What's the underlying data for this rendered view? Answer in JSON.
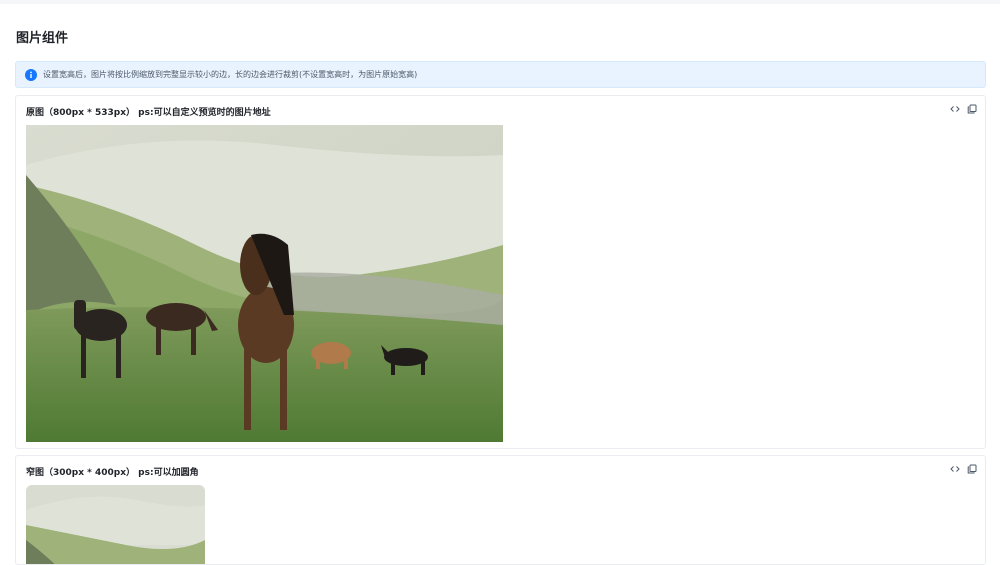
{
  "page": {
    "title": "图片组件"
  },
  "notice": {
    "icon": "info-icon",
    "text": "设置宽高后，图片将按比例缩放到完整显示较小的边，长的边会进行裁剪(不设置宽高时，为图片原始宽高)",
    "accent": "#1677ff"
  },
  "examples": [
    {
      "title": "原图（800px * 533px） ps:可以自定义预览时的图片地址",
      "tools": [
        "code-icon",
        "copy-icon"
      ]
    },
    {
      "title": "窄图（300px * 400px） ps:可以加圆角",
      "tools": [
        "code-icon",
        "copy-icon"
      ]
    }
  ]
}
